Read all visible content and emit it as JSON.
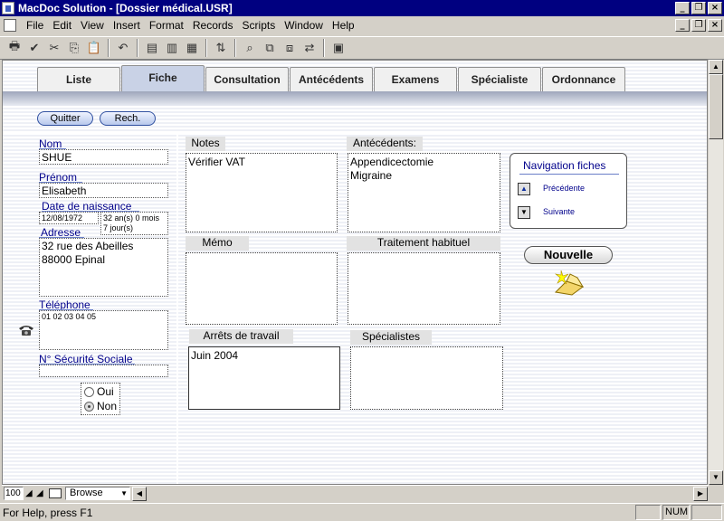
{
  "window": {
    "title": "MacDoc Solution - [Dossier médical.USR]"
  },
  "menubar": {
    "items": [
      "File",
      "Edit",
      "View",
      "Insert",
      "Format",
      "Records",
      "Scripts",
      "Window",
      "Help"
    ]
  },
  "toolbar": {
    "icons": [
      "print-icon",
      "spellcheck-icon",
      "cut-icon",
      "copy-icon",
      "paste-icon",
      "undo-icon",
      "new-record-icon",
      "duplicate-record-icon",
      "delete-record-icon",
      "sort-icon",
      "find-icon",
      "omit-icon",
      "show-all-icon",
      "replace-icon",
      "preview-icon"
    ]
  },
  "tabs": [
    "Liste",
    "Fiche",
    "Consultation",
    "Antécédents",
    "Examens",
    "Spécialiste",
    "Ordonnance"
  ],
  "active_tab": "Fiche",
  "buttons": {
    "quit": "Quitter",
    "search": "Rech."
  },
  "patient": {
    "nom_label": "Nom",
    "nom": "SHUE",
    "prenom_label": "Prénom",
    "prenom": "Elisabeth",
    "dob_label": "Date de naissance",
    "dob": "12/08/1972",
    "age": "32 an(s) 0 mois 7 jour(s)",
    "adresse_label": "Adresse",
    "adresse_line1": "32 rue des Abeilles",
    "adresse_line2": "88000 Epinal",
    "telephone_label": "Téléphone",
    "telephone": "01 02 03 04 05",
    "secu_label": "N° Sécurité Sociale",
    "secu": "",
    "oui": "Oui",
    "non": "Non",
    "selected": "Non"
  },
  "sections": {
    "notes_label": "Notes",
    "notes": "Vérifier VAT",
    "antecedents_label": "Antécédents:",
    "antecedents_line1": "Appendicectomie",
    "antecedents_line2": "Migraine",
    "memo_label": "Mémo",
    "memo": "",
    "traitement_label": "Traitement habituel",
    "traitement": "",
    "arrets_label": "Arrêts de travail",
    "arrets": "Juin 2004",
    "specialistes_label": "Spécialistes",
    "specialistes": ""
  },
  "nav": {
    "title": "Navigation fiches",
    "prev": "Précédente",
    "next": "Suivante",
    "new": "Nouvelle"
  },
  "bottombar": {
    "zoom": "100",
    "mode": "Browse"
  },
  "status": {
    "help": "For Help, press F1",
    "num": "NUM"
  },
  "colors": {
    "titlebar": "#000080",
    "label": "#00008b",
    "active_tab": "#c9d2e6"
  }
}
